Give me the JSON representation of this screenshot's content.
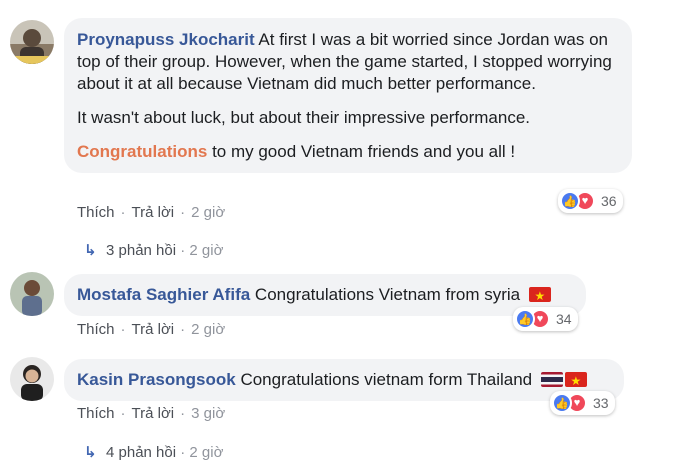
{
  "comments": [
    {
      "author": "Proynapuss Jkocharit",
      "paragraphs": [
        "At first I was a bit worried since Jordan was on top of their group. However, when the game started, I stopped worrying about it at all because Vietnam did much better performance.",
        "It wasn't about luck, but about their impressive performance."
      ],
      "highlight": "Congratulations",
      "closing": " to my good Vietnam friends and you all !",
      "like_label": "Thích",
      "reply_label": "Trả lời",
      "time": "2 giờ",
      "reaction_count": "36",
      "replies_label": "3 phản hồi",
      "replies_time": "2 giờ"
    },
    {
      "author": "Mostafa Saghier Afifa",
      "text": "Congratulations Vietnam from syria",
      "flags": [
        "vietnam-flag"
      ],
      "like_label": "Thích",
      "reply_label": "Trả lời",
      "time": "2 giờ",
      "reaction_count": "34"
    },
    {
      "author": "Kasin Prasongsook",
      "text": "Congratulations vietnam form Thailand",
      "flags": [
        "thailand-flag",
        "vietnam-flag"
      ],
      "like_label": "Thích",
      "reply_label": "Trả lời",
      "time": "3 giờ",
      "reaction_count": "33",
      "replies_label": "4 phản hồi",
      "replies_time": "2 giờ"
    }
  ],
  "colors": {
    "author": "#385898",
    "highlight": "#e2774f",
    "bubble": "#f2f3f5",
    "like": "#4a7af0",
    "love": "#f0485a"
  },
  "icons": [
    "like-reaction-icon",
    "love-reaction-icon",
    "reply-arrow-icon"
  ]
}
